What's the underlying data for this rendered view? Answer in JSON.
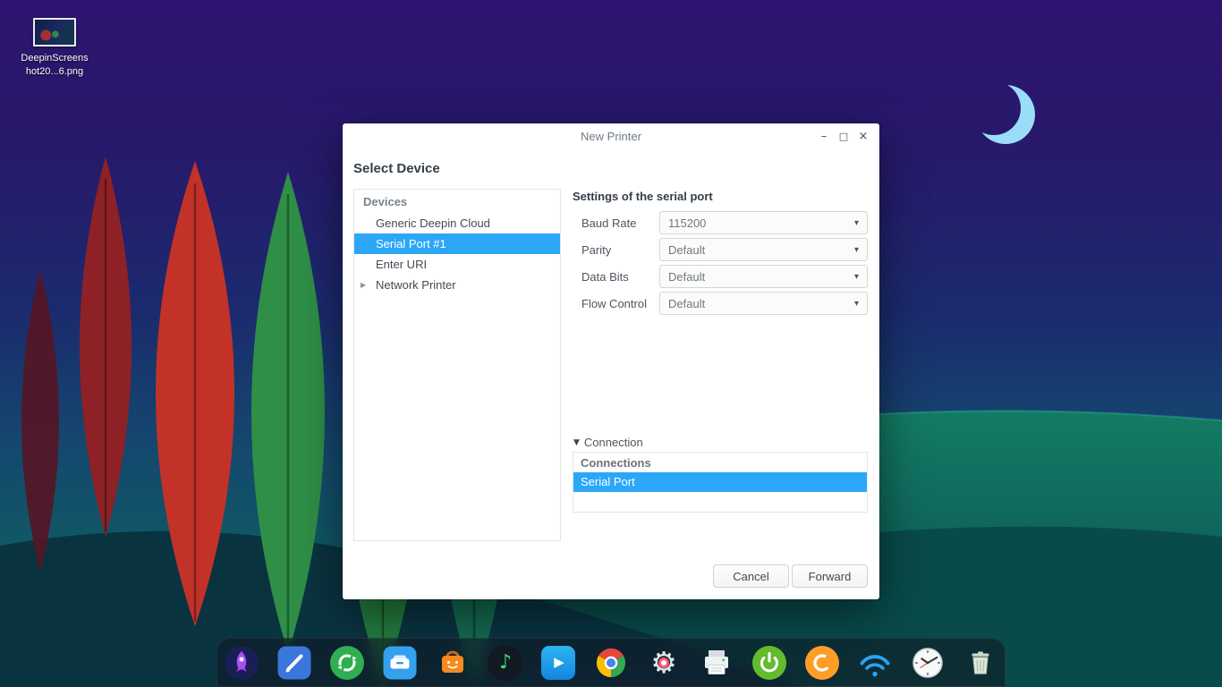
{
  "ui": {
    "dropdown_caret": "▾"
  },
  "desktop": {
    "icon_label_line1": "DeepinScreens",
    "icon_label_line2": "hot20...6.png"
  },
  "window": {
    "title": "New Printer",
    "controls": {
      "minimize": "–",
      "maximize": "□",
      "close": "×"
    },
    "heading": "Select Device",
    "devices": {
      "header": "Devices",
      "expander_glyph": "▶",
      "items": [
        {
          "label": "Generic Deepin Cloud",
          "selected": false
        },
        {
          "label": "Serial Port #1",
          "selected": true
        },
        {
          "label": "Enter URI",
          "selected": false
        },
        {
          "label": "Network Printer",
          "selected": false,
          "expandable": true
        }
      ]
    },
    "settings": {
      "heading": "Settings of the serial port",
      "fields": [
        {
          "label": "Baud Rate",
          "value": "115200"
        },
        {
          "label": "Parity",
          "value": "Default"
        },
        {
          "label": "Data Bits",
          "value": "Default"
        },
        {
          "label": "Flow Control",
          "value": "Default"
        }
      ],
      "connection": {
        "toggle_glyph": "▼",
        "toggle_label": "Connection",
        "list_header": "Connections",
        "items": [
          {
            "label": "Serial Port",
            "selected": true
          }
        ]
      }
    },
    "footer": {
      "cancel": "Cancel",
      "forward": "Forward"
    }
  },
  "dock": {
    "icons": [
      {
        "name": "launcher"
      },
      {
        "name": "text-editor"
      },
      {
        "name": "software-updater"
      },
      {
        "name": "file-manager"
      },
      {
        "name": "app-store"
      },
      {
        "name": "music-player",
        "glyph": "♪"
      },
      {
        "name": "video-player",
        "glyph": "▶"
      },
      {
        "name": "chrome-browser"
      },
      {
        "name": "control-center",
        "glyph": "⚙"
      },
      {
        "name": "printer-settings"
      },
      {
        "name": "power-manager"
      },
      {
        "name": "orange-app"
      },
      {
        "name": "network-wifi"
      },
      {
        "name": "clock"
      },
      {
        "name": "trash"
      }
    ]
  },
  "colors": {
    "selection_blue": "#2ca7f8",
    "dock_bg": "rgba(16,22,34,0.55)",
    "moon": "#9addf8"
  }
}
